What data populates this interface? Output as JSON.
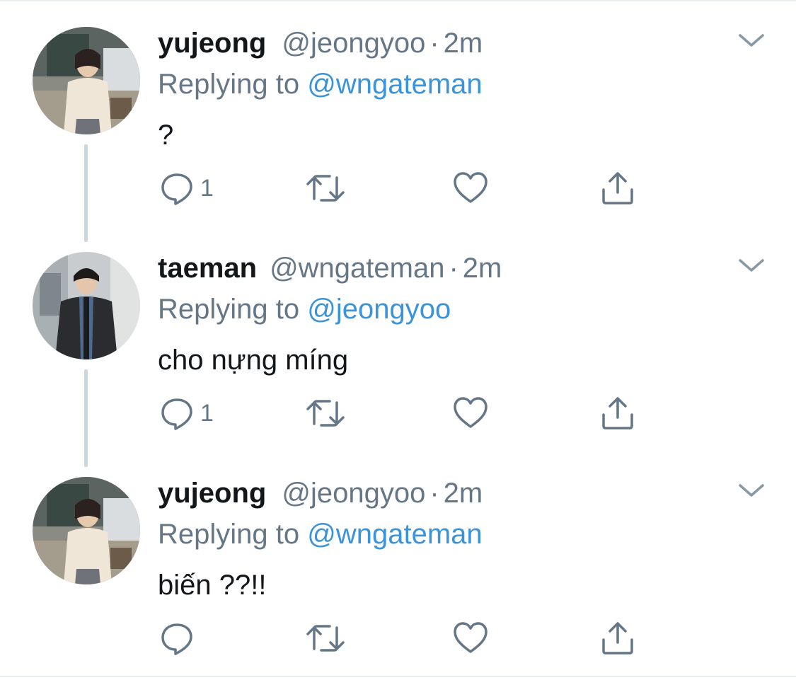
{
  "tweets": [
    {
      "display_name": "yujeong",
      "handle": "@jeongyoo",
      "separator": "·",
      "time": "2m",
      "replying_prefix": "Replying to",
      "replying_to": "@wngateman",
      "text": "?",
      "reply_count": "1",
      "avatar": "avatar-photo-yujeong"
    },
    {
      "display_name": "taeman",
      "handle": "@wngateman",
      "separator": "·",
      "time": "2m",
      "replying_prefix": "Replying to",
      "replying_to": "@jeongyoo",
      "text": "cho nựng míng",
      "reply_count": "1",
      "avatar": "avatar-photo-taeman"
    },
    {
      "display_name": "yujeong",
      "handle": "@jeongyoo",
      "separator": "·",
      "time": "2m",
      "replying_prefix": "Replying to",
      "replying_to": "@wngateman",
      "text": "biến ??!!",
      "reply_count": "",
      "avatar": "avatar-photo-yujeong"
    }
  ],
  "icons": {
    "reply": "reply-icon",
    "retweet": "retweet-icon",
    "like": "heart-icon",
    "share": "share-icon",
    "more": "chevron-down-icon"
  },
  "colors": {
    "text_primary": "#14171a",
    "text_secondary": "#657786",
    "link": "#3b94d9",
    "thread_line": "#ccd6dd"
  }
}
